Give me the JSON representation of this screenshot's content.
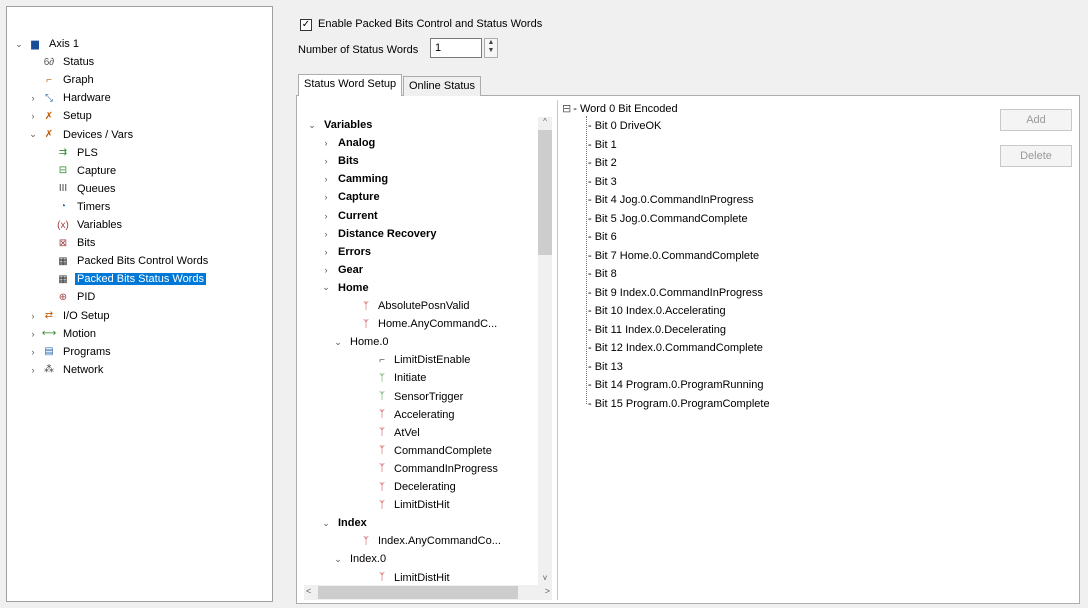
{
  "header": {
    "enable_checked": true,
    "enable_label": "Enable Packed Bits Control and Status Words",
    "num_words_label": "Number of Status Words",
    "num_words_value": "1"
  },
  "tabs": [
    {
      "label": "Status Word Setup",
      "active": true
    },
    {
      "label": "Online Status",
      "active": false
    }
  ],
  "project_tree": [
    {
      "label": "Axis 1",
      "level": 0,
      "arrow": "v",
      "icon": "axis-icon"
    },
    {
      "label": "Status",
      "level": 1,
      "arrow": "",
      "icon": "status-icon"
    },
    {
      "label": "Graph",
      "level": 1,
      "arrow": "",
      "icon": "graph-icon"
    },
    {
      "label": "Hardware",
      "level": 1,
      "arrow": ">",
      "icon": "hardware-icon"
    },
    {
      "label": "Setup",
      "level": 1,
      "arrow": ">",
      "icon": "setup-icon"
    },
    {
      "label": "Devices / Vars",
      "level": 1,
      "arrow": "v",
      "icon": "devices-icon"
    },
    {
      "label": "PLS",
      "level": 2,
      "arrow": "",
      "icon": "pls-icon"
    },
    {
      "label": "Capture",
      "level": 2,
      "arrow": "",
      "icon": "capture-icon"
    },
    {
      "label": "Queues",
      "level": 2,
      "arrow": "",
      "icon": "queues-icon"
    },
    {
      "label": "Timers",
      "level": 2,
      "arrow": "",
      "icon": "timer-icon"
    },
    {
      "label": "Variables",
      "level": 2,
      "arrow": "",
      "icon": "variables-icon"
    },
    {
      "label": "Bits",
      "level": 2,
      "arrow": "",
      "icon": "bits-icon"
    },
    {
      "label": "Packed Bits Control Words",
      "level": 2,
      "arrow": "",
      "icon": "packed-bits-icon"
    },
    {
      "label": "Packed Bits Status Words",
      "level": 2,
      "arrow": "",
      "icon": "packed-bits-icon",
      "selected": true
    },
    {
      "label": "PID",
      "level": 2,
      "arrow": "",
      "icon": "pid-icon"
    },
    {
      "label": "I/O Setup",
      "level": 1,
      "arrow": ">",
      "icon": "io-icon"
    },
    {
      "label": "Motion",
      "level": 1,
      "arrow": ">",
      "icon": "motion-icon"
    },
    {
      "label": "Programs",
      "level": 1,
      "arrow": ">",
      "icon": "programs-icon"
    },
    {
      "label": "Network",
      "level": 1,
      "arrow": ">",
      "icon": "network-icon"
    }
  ],
  "variables_tree": [
    {
      "label": "Variables",
      "level": 0,
      "arrow": "v",
      "bold": true
    },
    {
      "label": "Analog",
      "level": 1,
      "arrow": ">",
      "bold": true
    },
    {
      "label": "Bits",
      "level": 1,
      "arrow": ">",
      "bold": true
    },
    {
      "label": "Camming",
      "level": 1,
      "arrow": ">",
      "bold": true
    },
    {
      "label": "Capture",
      "level": 1,
      "arrow": ">",
      "bold": true
    },
    {
      "label": "Current",
      "level": 1,
      "arrow": ">",
      "bold": true
    },
    {
      "label": "Distance Recovery",
      "level": 1,
      "arrow": ">",
      "bold": true
    },
    {
      "label": "Errors",
      "level": 1,
      "arrow": ">",
      "bold": true
    },
    {
      "label": "Gear",
      "level": 1,
      "arrow": ">",
      "bold": true
    },
    {
      "label": "Home",
      "level": 1,
      "arrow": "v",
      "bold": true
    },
    {
      "label": "AbsolutePosnValid",
      "level": 3,
      "arrow": "",
      "icon": "status-bit-icon"
    },
    {
      "label": "Home.AnyCommandC...",
      "level": 3,
      "arrow": "",
      "icon": "status-bit-icon"
    },
    {
      "label": "Home.0",
      "level": 2,
      "arrow": "v"
    },
    {
      "label": "LimitDistEnable",
      "level": 4,
      "arrow": "",
      "icon": "control-bit-icon"
    },
    {
      "label": "Initiate",
      "level": 4,
      "arrow": "",
      "icon": "initiate-bit-icon"
    },
    {
      "label": "SensorTrigger",
      "level": 4,
      "arrow": "",
      "icon": "initiate-bit-icon"
    },
    {
      "label": "Accelerating",
      "level": 4,
      "arrow": "",
      "icon": "status-bit-icon"
    },
    {
      "label": "AtVel",
      "level": 4,
      "arrow": "",
      "icon": "status-bit-icon"
    },
    {
      "label": "CommandComplete",
      "level": 4,
      "arrow": "",
      "icon": "status-bit-icon"
    },
    {
      "label": "CommandInProgress",
      "level": 4,
      "arrow": "",
      "icon": "status-bit-icon"
    },
    {
      "label": "Decelerating",
      "level": 4,
      "arrow": "",
      "icon": "status-bit-icon"
    },
    {
      "label": "LimitDistHit",
      "level": 4,
      "arrow": "",
      "icon": "status-bit-icon"
    },
    {
      "label": "Index",
      "level": 1,
      "arrow": "v",
      "bold": true
    },
    {
      "label": "Index.AnyCommandCo...",
      "level": 3,
      "arrow": "",
      "icon": "status-bit-icon"
    },
    {
      "label": "Index.0",
      "level": 2,
      "arrow": "v"
    },
    {
      "label": "LimitDistHit",
      "level": 4,
      "arrow": "",
      "icon": "status-bit-icon"
    }
  ],
  "word_tree": {
    "root": "Word 0  Bit Encoded",
    "bits": [
      "Bit 0  DriveOK",
      "Bit 1",
      "Bit 2",
      "Bit 3",
      "Bit 4  Jog.0.CommandInProgress",
      "Bit 5  Jog.0.CommandComplete",
      "Bit 6",
      "Bit 7  Home.0.CommandComplete",
      "Bit 8",
      "Bit 9  Index.0.CommandInProgress",
      "Bit 10  Index.0.Accelerating",
      "Bit 11  Index.0.Decelerating",
      "Bit 12  Index.0.CommandComplete",
      "Bit 13",
      "Bit 14  Program.0.ProgramRunning",
      "Bit 15  Program.0.ProgramComplete"
    ]
  },
  "buttons": {
    "add": "Add",
    "delete": "Delete"
  },
  "colors": {
    "selection": "#0078d7",
    "disabled_text": "#9a9a9a"
  }
}
